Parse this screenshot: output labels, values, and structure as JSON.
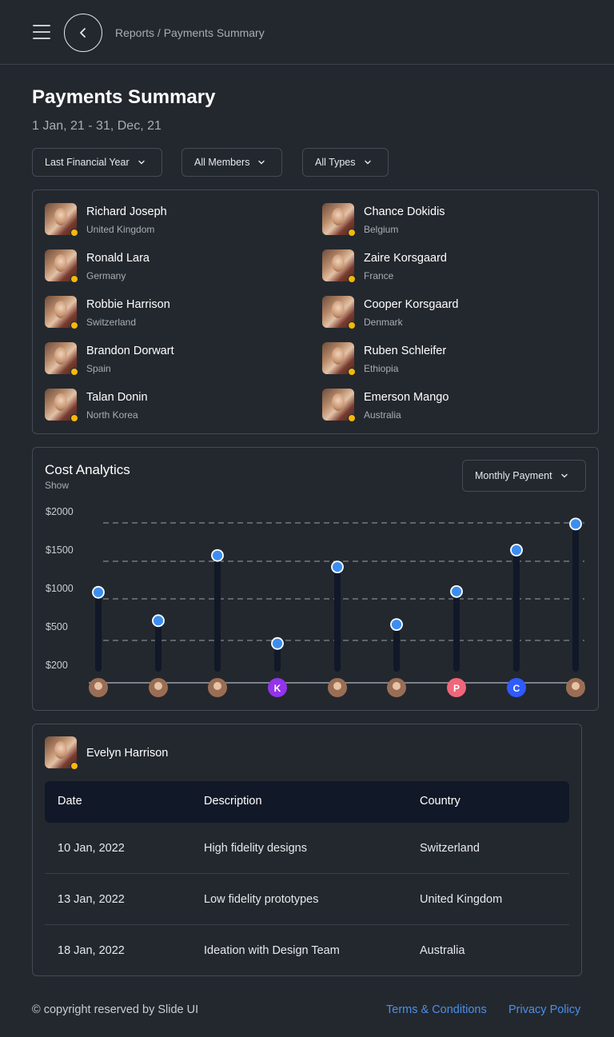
{
  "header": {
    "breadcrumb": "Reports / Payments Summary",
    "menu_icon": "hamburger-menu-icon",
    "back_icon": "chevron-left-icon"
  },
  "page": {
    "title": "Payments Summary",
    "date_range": "1 Jan, 21 - 31, Dec, 21"
  },
  "filters": [
    {
      "label": "Last Financial Year"
    },
    {
      "label": "All Members"
    },
    {
      "label": "All Types"
    }
  ],
  "members": [
    {
      "name": "Richard Joseph",
      "country": "United Kingdom"
    },
    {
      "name": "Chance Dokidis",
      "country": "Belgium"
    },
    {
      "name": "Ronald Lara",
      "country": "Germany"
    },
    {
      "name": "Zaire Korsgaard",
      "country": "France"
    },
    {
      "name": "Robbie Harrison",
      "country": "Switzerland"
    },
    {
      "name": "Cooper Korsgaard",
      "country": "Denmark"
    },
    {
      "name": "Brandon Dorwart",
      "country": "Spain"
    },
    {
      "name": "Ruben Schleifer",
      "country": "Ethiopia"
    },
    {
      "name": "Talan Donin",
      "country": "North Korea"
    },
    {
      "name": "Emerson Mango",
      "country": "Australia"
    }
  ],
  "cost_analytics": {
    "title": "Cost Analytics",
    "subtitle": "Show",
    "dropdown_label": "Monthly Payment"
  },
  "chart_data": {
    "type": "scatter",
    "style": "lollipop",
    "y_ticks": [
      "$2000",
      "$1500",
      "$1000",
      "$500",
      "$200"
    ],
    "y_tick_values": [
      2000,
      1500,
      1000,
      500,
      200
    ],
    "ylim": [
      200,
      2000
    ],
    "grid": "dashed horizontal",
    "values": [
      950,
      580,
      1430,
      370,
      1280,
      530,
      960,
      1500,
      1840
    ],
    "markers": [
      {
        "type": "avatar"
      },
      {
        "type": "avatar"
      },
      {
        "type": "avatar"
      },
      {
        "type": "letter",
        "letter": "K",
        "color": "#9333ea"
      },
      {
        "type": "avatar"
      },
      {
        "type": "avatar"
      },
      {
        "type": "letter",
        "letter": "P",
        "color": "#f0667a"
      },
      {
        "type": "letter",
        "letter": "C",
        "color": "#2f5bff"
      },
      {
        "type": "avatar"
      }
    ],
    "colors": {
      "point": "#3b8ef0",
      "stem": "#111827"
    }
  },
  "detail": {
    "name": "Evelyn Harrison",
    "columns": [
      "Date",
      "Description",
      "Country"
    ],
    "rows": [
      [
        "10 Jan, 2022",
        "High fidelity designs",
        "Switzerland"
      ],
      [
        "13 Jan, 2022",
        "Low fidelity prototypes",
        "United Kingdom"
      ],
      [
        "18 Jan, 2022",
        "Ideation with Design Team",
        "Australia"
      ]
    ]
  },
  "footer": {
    "copyright": "© copyright reserved by Slide UI",
    "terms": "Terms & Conditions",
    "privacy": "Privacy Policy"
  }
}
